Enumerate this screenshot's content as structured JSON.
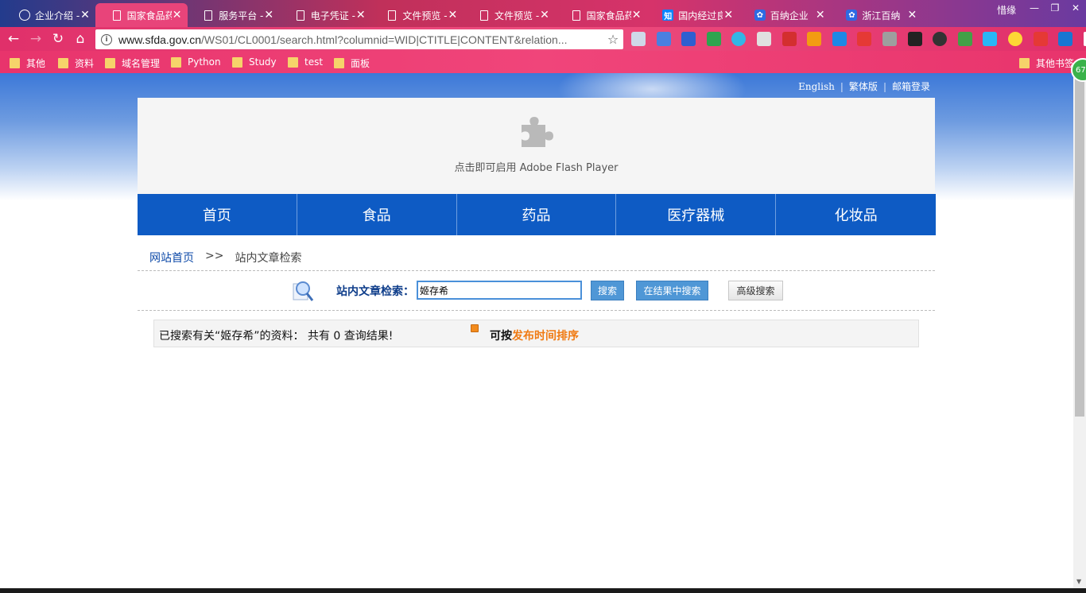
{
  "browser": {
    "tabs": [
      {
        "label": "企业介绍 -",
        "icon": "web"
      },
      {
        "label": "国家食品药",
        "icon": "doc",
        "active": true
      },
      {
        "label": "服务平台 -",
        "icon": "doc"
      },
      {
        "label": "电子凭证 -",
        "icon": "doc"
      },
      {
        "label": "文件预览 -",
        "icon": "doc"
      },
      {
        "label": "文件预览 -",
        "icon": "doc"
      },
      {
        "label": "国家食品药",
        "icon": "doc"
      },
      {
        "label": "国内经过良",
        "icon": "zhi"
      },
      {
        "label": "百纳企业",
        "icon": "paw"
      },
      {
        "label": "浙江百纳",
        "icon": "paw"
      }
    ],
    "profile_name": "惜缘",
    "zhi_glyph": "知",
    "url_host": "www.sfda.gov.cn",
    "url_path": "/WS01/CL0001/search.html?columnid=WID|CTITLE|CONTENT&relation...",
    "bookmarks": [
      "其他",
      "资料",
      "域名管理",
      "Python",
      "Study",
      "test",
      "面板"
    ],
    "other_bookmarks": "其他书签",
    "badge": "67"
  },
  "site": {
    "top_links": [
      "English",
      "繁体版",
      "邮箱登录"
    ],
    "flash_text": "点击即可启用 Adobe Flash Player",
    "nav": [
      "首页",
      "食品",
      "药品",
      "医疗器械",
      "化妆品"
    ],
    "breadcrumb": {
      "home": "网站首页",
      "separator": ">>",
      "current": "站内文章检索"
    },
    "search": {
      "label": "站内文章检索：",
      "query": "姬存希",
      "btn_search": "搜索",
      "btn_search_in_results": "在结果中搜索",
      "btn_advanced": "高级搜索"
    },
    "result": {
      "text": "已搜索有关“姬存希”的资料： 共有 0 查询结果!",
      "sort_prefix": "可按",
      "sort_link": "发布时间排序"
    }
  }
}
